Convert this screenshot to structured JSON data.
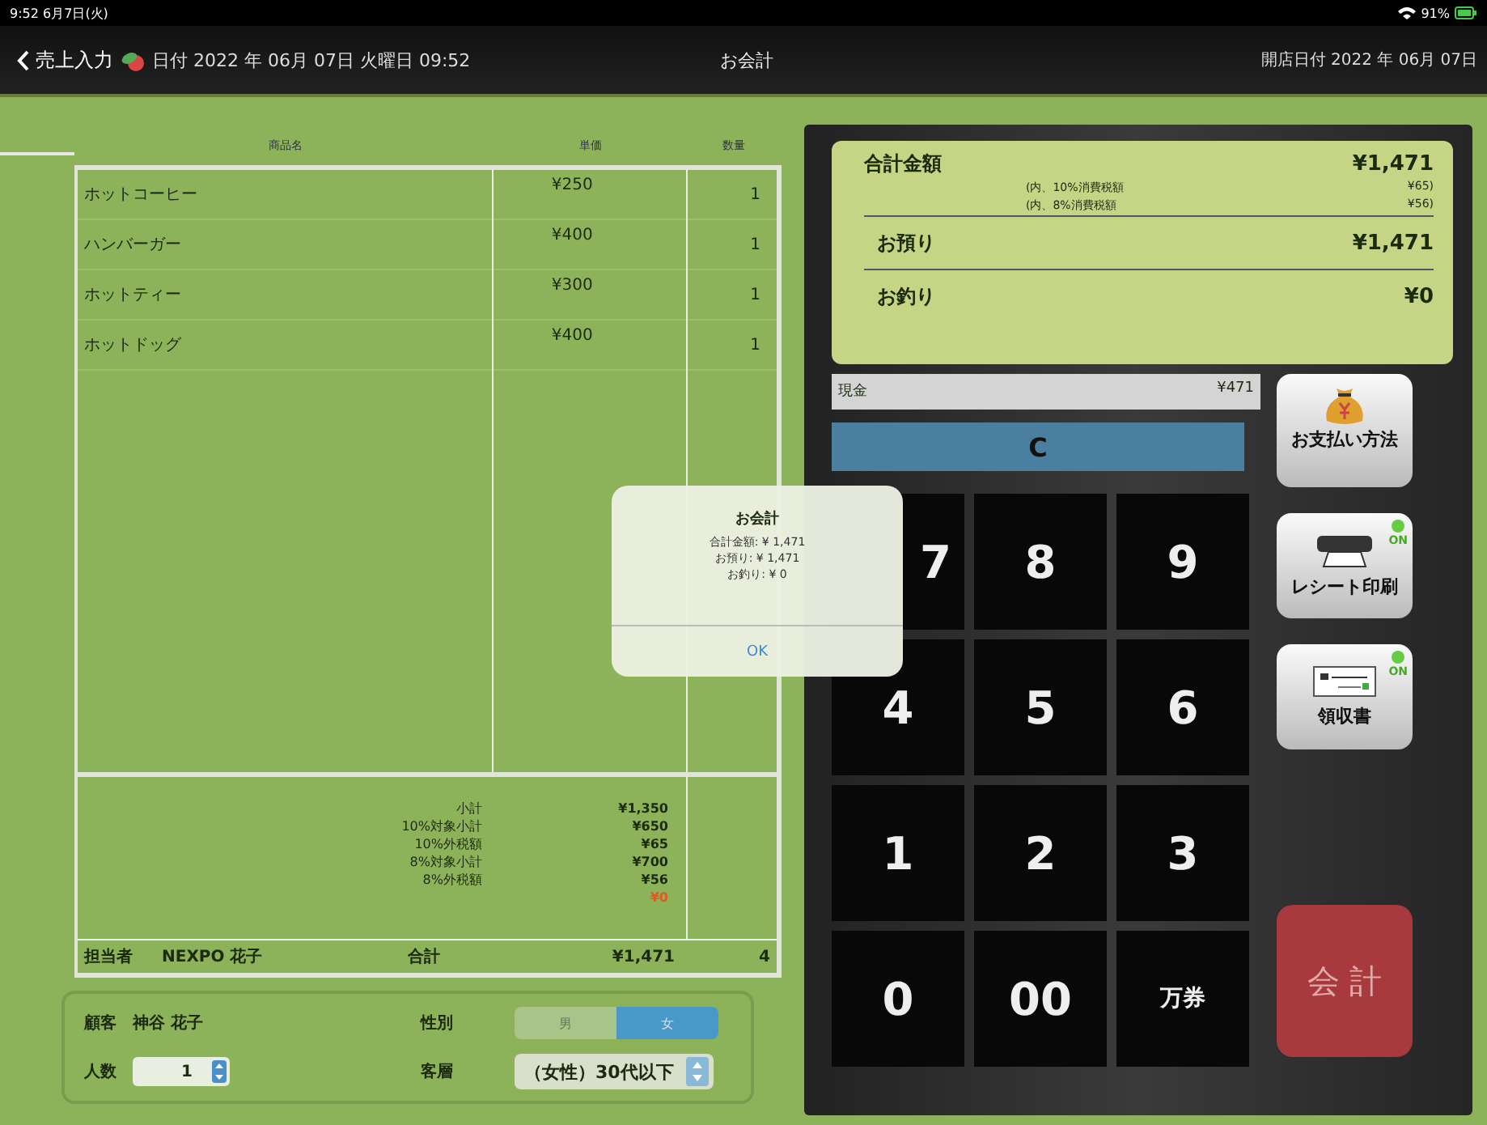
{
  "status_bar": {
    "time": "9:52  6月7日(火)",
    "battery": "91%"
  },
  "nav": {
    "back": "売上入力",
    "date": "日付 2022 年 06月 07日  火曜日 09:52",
    "title": "お会計",
    "open_date": "開店日付 2022 年 06月 07日"
  },
  "table": {
    "columns": [
      "商品名",
      "単価",
      "数量"
    ],
    "rows": [
      {
        "name": "ホットコーヒー",
        "price": "¥250",
        "qty": "1"
      },
      {
        "name": "ハンバーガー",
        "price": "¥400",
        "qty": "1"
      },
      {
        "name": "ホットティー",
        "price": "¥300",
        "qty": "1"
      },
      {
        "name": "ホットドッグ",
        "price": "¥400",
        "qty": "1"
      }
    ],
    "summary": [
      {
        "label": "小計",
        "value": "¥1,350",
        "kind": "normal"
      },
      {
        "label": "10%対象小計",
        "value": "¥650",
        "kind": "normal"
      },
      {
        "label": "10%外税額",
        "value": "¥65",
        "kind": "normal"
      },
      {
        "label": "8%対象小計",
        "value": "¥700",
        "kind": "normal"
      },
      {
        "label": "8%外税額",
        "value": "¥56",
        "kind": "normal"
      },
      {
        "value": "¥0",
        "kind": "discount"
      }
    ],
    "footer": {
      "staff_label": "担当者",
      "staff": "NEXPO 花子",
      "total_label": "合計",
      "total": "¥1,471",
      "count": "4"
    }
  },
  "customer": {
    "label": "顧客",
    "name": "神谷 花子",
    "gender_label": "性別",
    "genders": [
      {
        "label": "男",
        "selected": false
      },
      {
        "label": "女",
        "selected": true
      }
    ],
    "people_label": "人数",
    "people": "1",
    "segment_label": "客層",
    "segment": "（女性）30代以下"
  },
  "display": {
    "total_label": "合計金額",
    "total": "¥1,471",
    "tax_lines": [
      {
        "label": "(内、10%消費税額",
        "value": "¥65)"
      },
      {
        "label": "(内、8%消費税額",
        "value": "¥56)"
      }
    ],
    "received_label": "お預り",
    "received": "¥1,471",
    "change_label": "お釣り",
    "change": "¥0"
  },
  "cash": {
    "label": "現金",
    "value": "¥471"
  },
  "clear_key": "C",
  "keys": [
    "7",
    "8",
    "9",
    "4",
    "5",
    "6",
    "1",
    "2",
    "3",
    "0",
    "00",
    "万券"
  ],
  "side": {
    "pay_method": "お支払い方法",
    "print": {
      "label": "レシート印刷",
      "on": true,
      "state": "ON"
    },
    "receipt": {
      "label": "領収書",
      "on": true,
      "state": "ON"
    },
    "checkout": "会 計"
  },
  "dialog": {
    "title": "お会計",
    "lines": [
      "合計金額: ¥ 1,471",
      "お預り: ¥ 1,471",
      "お釣り: ¥ 0"
    ],
    "ok": "OK"
  }
}
